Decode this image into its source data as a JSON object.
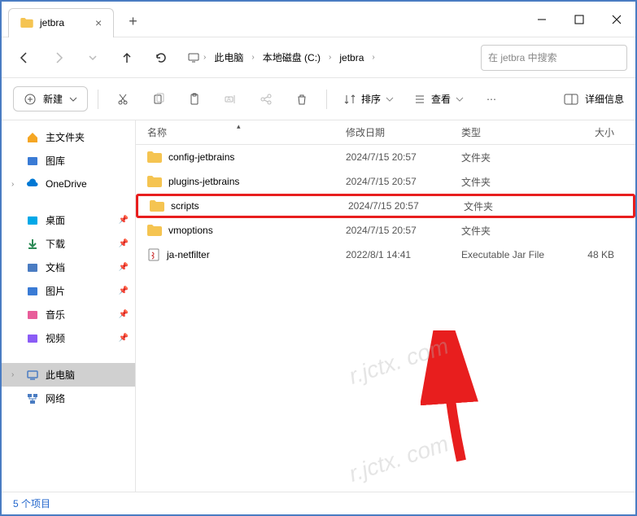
{
  "window": {
    "tab_title": "jetbra"
  },
  "breadcrumb": {
    "items": [
      "此电脑",
      "本地磁盘 (C:)",
      "jetbra"
    ]
  },
  "search": {
    "placeholder": "在 jetbra 中搜索"
  },
  "toolbar": {
    "new_label": "新建",
    "sort_label": "排序",
    "view_label": "查看",
    "details_label": "详细信息"
  },
  "sidebar": {
    "groups": [
      {
        "items": [
          {
            "label": "主文件夹",
            "icon": "home",
            "color": "#f5a623"
          },
          {
            "label": "图库",
            "icon": "gallery",
            "color": "#3a7bd5"
          },
          {
            "label": "OneDrive",
            "icon": "cloud",
            "color": "#0078d4",
            "chev": true
          }
        ]
      },
      {
        "items": [
          {
            "label": "桌面",
            "icon": "desktop",
            "color": "#00a8e8",
            "pin": true
          },
          {
            "label": "下载",
            "icon": "download",
            "color": "#2e8b57",
            "pin": true
          },
          {
            "label": "文档",
            "icon": "doc",
            "color": "#4a7cc2",
            "pin": true
          },
          {
            "label": "图片",
            "icon": "picture",
            "color": "#3a7bd5",
            "pin": true
          },
          {
            "label": "音乐",
            "icon": "music",
            "color": "#e85d9a",
            "pin": true
          },
          {
            "label": "视频",
            "icon": "video",
            "color": "#8b5cf6",
            "pin": true
          }
        ]
      },
      {
        "items": [
          {
            "label": "此电脑",
            "icon": "pc",
            "color": "#4a7cc2",
            "chev": true,
            "active": true
          },
          {
            "label": "网络",
            "icon": "network",
            "color": "#4a7cc2"
          }
        ]
      }
    ]
  },
  "columns": {
    "name": "名称",
    "date": "修改日期",
    "type": "类型",
    "size": "大小"
  },
  "files": [
    {
      "name": "config-jetbrains",
      "date": "2024/7/15 20:57",
      "type": "文件夹",
      "size": "",
      "icon": "folder"
    },
    {
      "name": "plugins-jetbrains",
      "date": "2024/7/15 20:57",
      "type": "文件夹",
      "size": "",
      "icon": "folder"
    },
    {
      "name": "scripts",
      "date": "2024/7/15 20:57",
      "type": "文件夹",
      "size": "",
      "icon": "folder",
      "highlighted": true
    },
    {
      "name": "vmoptions",
      "date": "2024/7/15 20:57",
      "type": "文件夹",
      "size": "",
      "icon": "folder"
    },
    {
      "name": "ja-netfilter",
      "date": "2022/8/1 14:41",
      "type": "Executable Jar File",
      "size": "48 KB",
      "icon": "jar"
    }
  ],
  "statusbar": {
    "text": "5 个项目"
  },
  "watermark": "r.jctx. com"
}
